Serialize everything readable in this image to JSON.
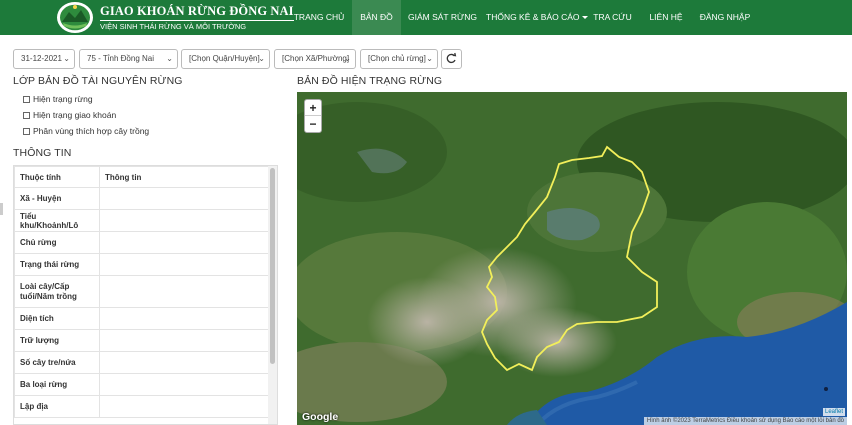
{
  "brand": {
    "title": "GIAO KHOÁN RỪNG ĐỒNG NAI",
    "subtitle": "VIỆN SINH THÁI RỪNG VÀ MÔI TRƯỜNG",
    "logo_icon": "forest-emblem-icon"
  },
  "nav": {
    "items": [
      {
        "label": "TRANG CHỦ",
        "active": false
      },
      {
        "label": "BẢN ĐỒ",
        "active": true
      },
      {
        "label": "GIÁM SÁT RỪNG",
        "active": false
      },
      {
        "label": "THỐNG KÊ & BÁO CÁO",
        "active": false,
        "dropdown": true
      },
      {
        "label": "TRA CỨU",
        "active": false
      },
      {
        "label": "LIÊN HỆ",
        "active": false
      },
      {
        "label": "ĐĂNG NHẬP",
        "active": false
      }
    ]
  },
  "filters": {
    "date": "31-12-2021",
    "province": "75 - Tỉnh Đồng Nai",
    "district": "[Chọn Quận/Huyện]",
    "commune": "[Chọn Xã/Phường]",
    "owner": "[Chọn chủ rừng]",
    "refresh_icon": "refresh-icon"
  },
  "layers": {
    "title": "LỚP BẢN ĐỒ TÀI NGUYÊN RỪNG",
    "items": [
      {
        "label": "Hiện trạng rừng",
        "checked": false
      },
      {
        "label": "Hiện trạng giao khoán",
        "checked": false
      },
      {
        "label": "Phân vùng thích hợp cây trồng",
        "checked": false
      }
    ]
  },
  "info": {
    "title": "THÔNG TIN",
    "headers": [
      "Thuộc tính",
      "Thông tin"
    ],
    "rows": [
      {
        "attr": "Xã - Huyện",
        "value": ""
      },
      {
        "attr": "Tiểu khu/Khoảnh/Lô",
        "value": ""
      },
      {
        "attr": "Chủ rừng",
        "value": ""
      },
      {
        "attr": "Trạng thái rừng",
        "value": ""
      },
      {
        "attr": "Loài cây/Cấp tuổi/Năm trồng",
        "value": ""
      },
      {
        "attr": "Diện tích",
        "value": ""
      },
      {
        "attr": "Trữ lượng",
        "value": ""
      },
      {
        "attr": "Số cây tre/nứa",
        "value": ""
      },
      {
        "attr": "Ba loại rừng",
        "value": ""
      },
      {
        "attr": "Lập địa",
        "value": ""
      }
    ]
  },
  "map": {
    "title": "BẢN ĐỒ HIỆN TRẠNG RỪNG",
    "zoom_in": "+",
    "zoom_out": "−",
    "google_logo": "Google",
    "attribution": "Hình ảnh ©2023 TerraMetrics   Điều khoản sử dụng   Báo cáo một lỗi bản đồ",
    "leaflet": "Leaflet",
    "boundary_color": "#f2ef5a"
  },
  "colors": {
    "header_bg": "#1d7a3a",
    "nav_active_bg": "#3b8a52",
    "forest": "#3f6b2e",
    "sea": "#1f5aa6"
  }
}
